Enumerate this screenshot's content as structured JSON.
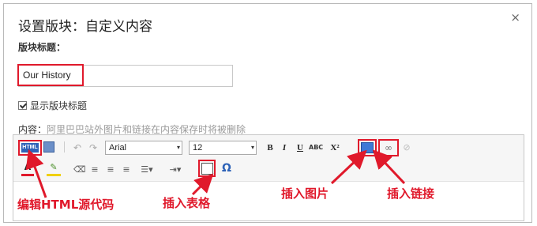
{
  "dialog": {
    "title": "设置版块：自定义内容",
    "close_symbol": "×"
  },
  "form": {
    "block_title_label": "版块标题：",
    "block_title_value": "Our History",
    "show_title_checkbox_label": "显示版块标题",
    "show_title_checked": true,
    "content_label": "内容：",
    "content_hint": "阿里巴巴站外图片和链接在内容保存时将被删除"
  },
  "toolbar": {
    "html_label": "HTML",
    "undo": "↶",
    "redo": "↷",
    "font_family": "Arial",
    "font_size": "12",
    "dropdown_arrow": "▾",
    "bold": "B",
    "italic": "I",
    "underline": "U",
    "strike": "ABC",
    "superscript": "X²",
    "link_icon": "∞",
    "unlink_icon": "⊘",
    "font_color": "A",
    "bg_color": "✎",
    "eraser": "⌫",
    "align_left": "≡",
    "align_center": "≡",
    "align_right": "≡",
    "list": "☰▾",
    "indent": "⇥▾",
    "omega": "Ω"
  },
  "annotations": {
    "edit_html": "编辑HTML源代码",
    "insert_table": "插入表格",
    "insert_image": "插入图片",
    "insert_link": "插入链接"
  },
  "colors": {
    "highlight": "#e0192b",
    "accent_blue": "#2e63b8"
  }
}
